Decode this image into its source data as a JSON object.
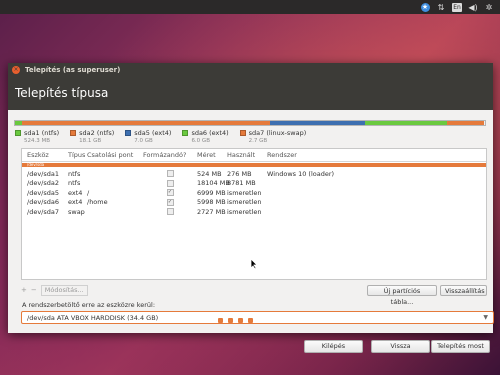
{
  "topbar": {
    "icons": [
      "accessibility-icon",
      "network-icon",
      "keyboard-layout-icon",
      "volume-icon",
      "settings-gear-icon"
    ],
    "keyboard_layout": "En",
    "accessibility_glyph": "★"
  },
  "window": {
    "title": "Telepítés (as superuser)",
    "header": "Telepítés típusa"
  },
  "partition_bar": {
    "segments": [
      {
        "name": "sda1",
        "color": "#6ac93f",
        "fraction": 0.0153
      },
      {
        "name": "sda2",
        "color": "#e57a3b",
        "fraction": 0.5263
      },
      {
        "name": "sda5",
        "color": "#3d6fb0",
        "fraction": 0.2035
      },
      {
        "name": "sda6",
        "color": "#6ac93f",
        "fraction": 0.1744
      },
      {
        "name": "sda7",
        "color": "#e57a3b",
        "fraction": 0.0785
      }
    ]
  },
  "legend": [
    {
      "label": "sda1 (ntfs)",
      "size": "524.3 MB",
      "color": "#6ac93f"
    },
    {
      "label": "sda2 (ntfs)",
      "size": "18.1 GB",
      "color": "#e57a3b"
    },
    {
      "label": "sda5 (ext4)",
      "size": "7.0 GB",
      "color": "#3d6fb0"
    },
    {
      "label": "sda6 (ext4)",
      "size": "6.0 GB",
      "color": "#6ac93f"
    },
    {
      "label": "sda7 (linux-swap)",
      "size": "2.7 GB",
      "color": "#e57a3b"
    }
  ],
  "table": {
    "headers": [
      "Eszköz",
      "Típus",
      "Csatolási pont",
      "Formázandó?",
      "Méret",
      "Használt",
      "Rendszer"
    ],
    "selected_row_label": "/dev/sda",
    "rows": [
      {
        "device": "/dev/sda1",
        "type": "ntfs",
        "mount": "",
        "format": false,
        "size": "524 MB",
        "used": "276 MB",
        "system": "Windows 10 (loader)"
      },
      {
        "device": "/dev/sda2",
        "type": "ntfs",
        "mount": "",
        "format": false,
        "size": "18104 MB",
        "used": "8781 MB",
        "system": ""
      },
      {
        "device": "/dev/sda5",
        "type": "ext4",
        "mount": "/",
        "format": true,
        "size": "6999 MB",
        "used": "ismeretlen",
        "system": ""
      },
      {
        "device": "/dev/sda6",
        "type": "ext4",
        "mount": "/home",
        "format": true,
        "size": "5998 MB",
        "used": "ismeretlen",
        "system": ""
      },
      {
        "device": "/dev/sda7",
        "type": "swap",
        "mount": "",
        "format": false,
        "size": "2727 MB",
        "used": "ismeretlen",
        "system": ""
      }
    ]
  },
  "toolbar": {
    "add": "+",
    "remove": "−",
    "modify": "Módosítás...",
    "new_table": "Új partíciós tábla...",
    "revert": "Visszaállítás"
  },
  "bootloader": {
    "label": "A rendszerbetöltő erre az eszközre kerül:",
    "value": "/dev/sda   ATA VBOX HARDDISK (34.4 GB)"
  },
  "actions": {
    "quit": "Kilépés",
    "back": "Vissza",
    "install": "Telepítés most"
  },
  "progress": {
    "total_steps": 7,
    "current_step": 4,
    "active_color": "#e57a3b",
    "inactive_color": "#ffffff"
  }
}
